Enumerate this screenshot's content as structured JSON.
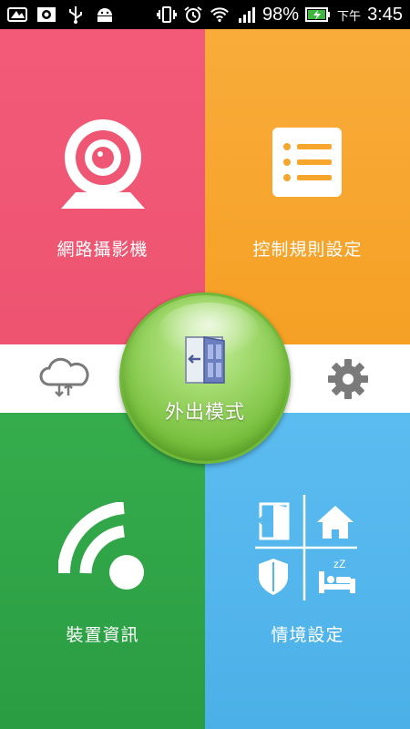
{
  "status_bar": {
    "battery_percent": "98%",
    "time_prefix": "下午",
    "time": "3:45",
    "icons": [
      "screenshot-icon",
      "image-icon",
      "usb-icon",
      "android-icon",
      "vibrate-icon",
      "alarm-icon",
      "wifi-icon",
      "signal-icon",
      "battery-charging-icon"
    ]
  },
  "tiles": {
    "camera": {
      "label": "網路攝影機",
      "icon": "webcam-icon",
      "color": "#ef5673"
    },
    "rules": {
      "label": "控制規則設定",
      "icon": "list-icon",
      "color": "#f7a62d"
    },
    "device": {
      "label": "裝置資訊",
      "icon": "wireless-signal-icon",
      "color": "#30a448"
    },
    "scene": {
      "label": "情境設定",
      "icon": "scene-grid-icon",
      "color": "#52b5ec"
    }
  },
  "center": {
    "label": "外出模式",
    "icon": "door-exit-icon",
    "color": "#8ccf55"
  },
  "band": {
    "left_icon": "cloud-sync-icon",
    "right_icon": "gear-icon"
  }
}
